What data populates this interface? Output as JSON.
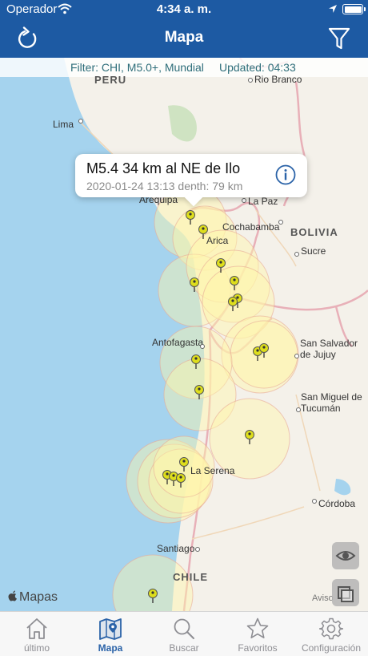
{
  "status_bar": {
    "carrier": "Operador",
    "time": "4:34 a. m."
  },
  "nav": {
    "title": "Mapa",
    "refresh_icon": "refresh-icon",
    "filter_icon": "funnel-icon"
  },
  "filter_strip": {
    "filter_text": "Filter: CHI, M5.0+, Mundial",
    "updated_text": "Updated: 04:33"
  },
  "callout": {
    "title": "M5.4 34 km al NE de Ilo",
    "subtitle": "2020-01-24 13:13  depth: 79 km",
    "info_icon": "info-icon"
  },
  "map": {
    "countries": [
      "PERU",
      "BOLIVIA",
      "CHILE"
    ],
    "places": [
      "Rio Branco",
      "Lima",
      "Arequipa",
      "La Paz",
      "Cochabamba",
      "Arica",
      "Sucre",
      "Antofagasta",
      "San Salvador de Jujuy",
      "San Miguel de Tucumán",
      "La Serena",
      "Córdoba",
      "Santiago",
      "Aviso"
    ],
    "attribution": "Mapas",
    "quake_marker_count": 20
  },
  "colors": {
    "header": "#1d5aa3",
    "accent": "#2b63a8",
    "ocean": "#a5d3ee",
    "land": "#f4f1ea",
    "marker": "#dede1c"
  },
  "tabs": [
    {
      "label": "último",
      "icon": "home-icon",
      "active": false
    },
    {
      "label": "Mapa",
      "icon": "map-icon",
      "active": true
    },
    {
      "label": "Buscar",
      "icon": "search-icon",
      "active": false
    },
    {
      "label": "Favoritos",
      "icon": "star-icon",
      "active": false
    },
    {
      "label": "Configuración",
      "icon": "gear-icon",
      "active": false
    }
  ]
}
